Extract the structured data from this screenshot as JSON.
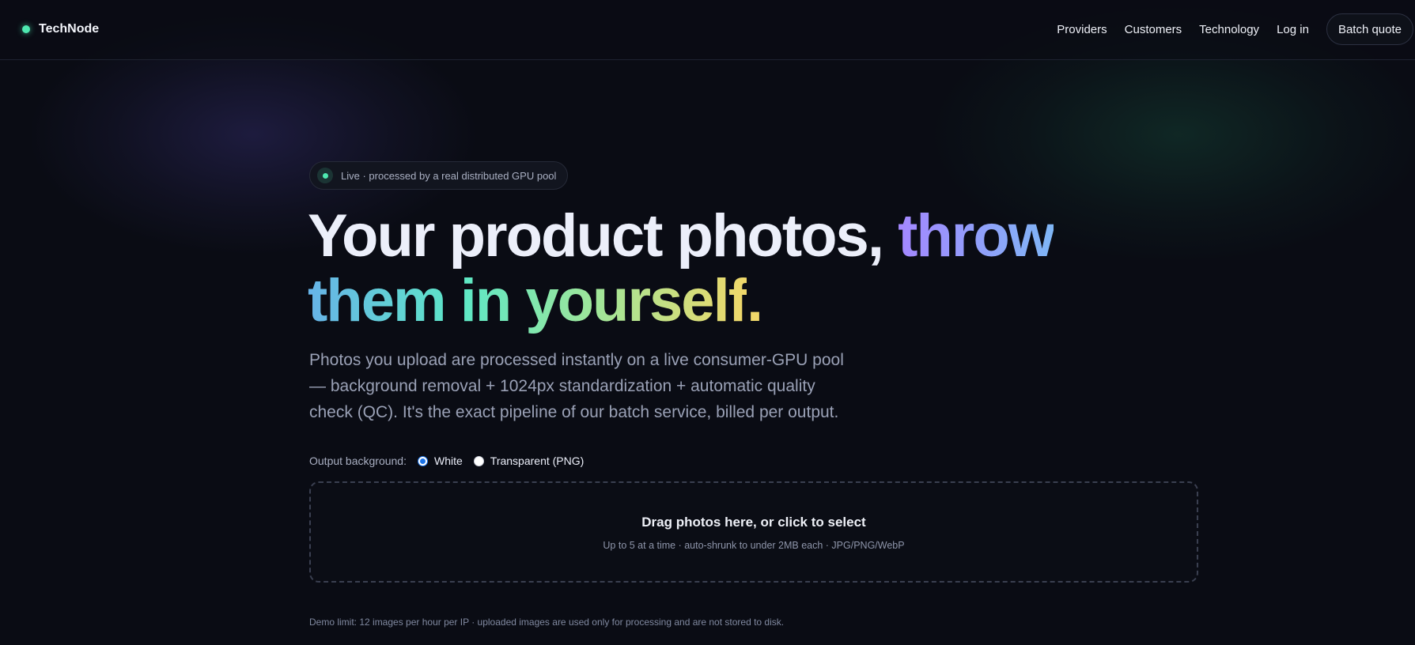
{
  "brand": {
    "name": "TechNode"
  },
  "nav": {
    "links": [
      "Providers",
      "Customers",
      "Technology",
      "Log in"
    ],
    "cta": "Batch quote"
  },
  "hero": {
    "badge": "Live · processed by a real distributed GPU pool",
    "headline_part1": "Your product photos, ",
    "headline_highlight1": "throw",
    "headline_highlight2": "them in yourself",
    "headline_end": ".",
    "subtext": "Photos you upload are processed instantly on a live consumer-GPU pool — background removal + 1024px standardization + automatic quality check (QC). It's the exact pipeline of our batch service, billed per output."
  },
  "output_background": {
    "label": "Output background:",
    "options": [
      "White",
      "Transparent (PNG)"
    ],
    "selected": "White"
  },
  "dropzone": {
    "title": "Drag photos here, or click to select",
    "subtitle": "Up to 5 at a time · auto-shrunk to under 2MB each · JPG/PNG/WebP"
  },
  "footer_note": "Demo limit: 12 images per hour per IP · uploaded images are used only for processing and are not stored to disk.",
  "colors": {
    "background": "#0a0c14",
    "accent_green": "#4ee8b0",
    "gradient_purple": "#a487ff",
    "gradient_yellow": "#f0d86a"
  }
}
